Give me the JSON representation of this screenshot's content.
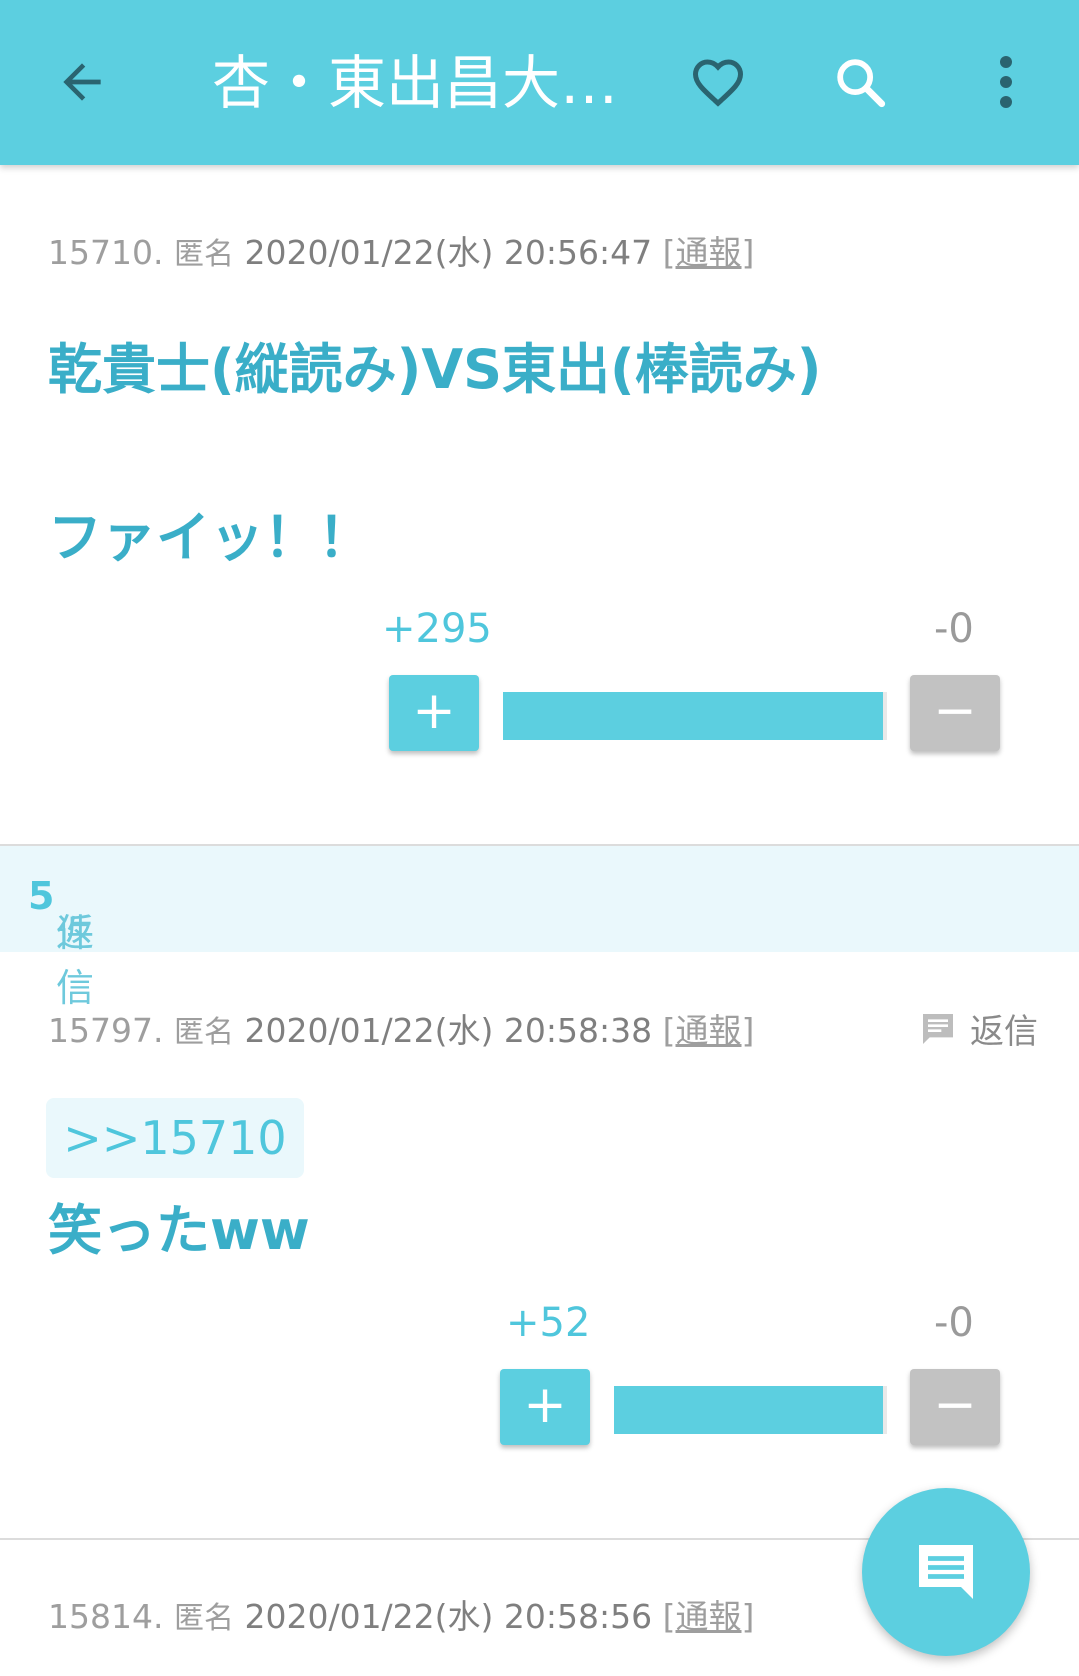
{
  "appbar": {
    "title": "杏・東出昌大…",
    "icons": [
      "back-arrow-icon",
      "heart-icon",
      "search-icon",
      "more-vert-icon"
    ]
  },
  "posts": [
    {
      "number": "15710.",
      "author": "匿名",
      "datetime": "2020/01/22(水) 20:56:47",
      "report_open": "[",
      "report": "通報",
      "report_close": "]",
      "line1": "乾貴士(縦読み)VS東出(棒読み)",
      "line2": "ファイッ！！",
      "plus_count": "+295",
      "minus_count": "-0",
      "plus_label": "+",
      "minus_label": "−",
      "ratio": 1.0
    },
    {
      "number": "15797.",
      "author": "匿名",
      "datetime": "2020/01/22(水) 20:58:38",
      "report_open": "[",
      "report": "通報",
      "report_close": "]",
      "reply_label": "返信",
      "anchor": ">>15710",
      "line1": "笑ったww",
      "plus_count": "+52",
      "minus_count": "-0",
      "plus_label": "+",
      "minus_label": "−",
      "ratio": 1.0
    },
    {
      "number": "15814.",
      "author": "匿名",
      "datetime": "2020/01/22(水) 20:58:56",
      "report_open": "[",
      "report": "通報",
      "report_close": "]"
    }
  ],
  "replies_header": {
    "prefix": "返信",
    "count": "5",
    "suffix": "件"
  },
  "fab": {
    "icon": "comment-icon"
  },
  "colors": {
    "accent": "#5ccfe0",
    "text_accent": "#3aaec8",
    "minus": "#c2c2c2"
  }
}
